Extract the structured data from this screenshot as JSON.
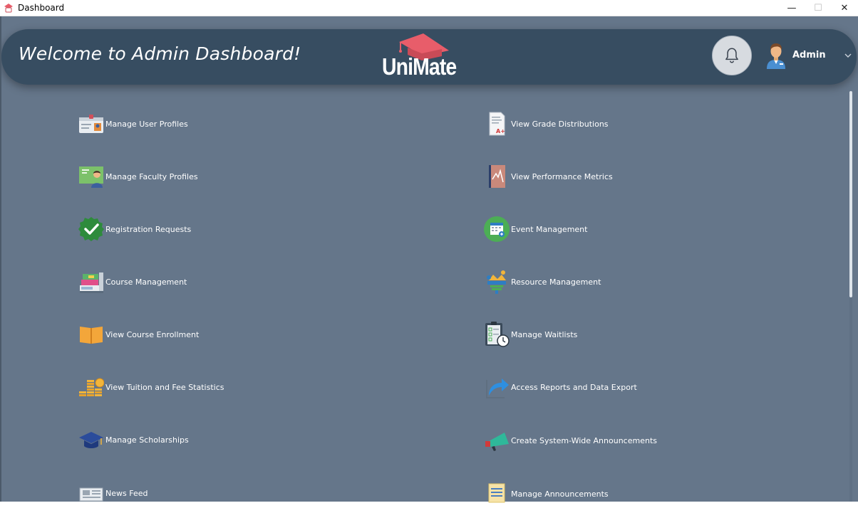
{
  "window": {
    "title": "Dashboard",
    "minimize": "—",
    "maximize": "☐",
    "close": "✕"
  },
  "header": {
    "welcome": "Welcome to Admin Dashboard!",
    "logo_text": "UniMate",
    "user_name": "Admin"
  },
  "menu": {
    "left": [
      {
        "label": "Manage User Profiles",
        "icon": "id-card-icon"
      },
      {
        "label": "Manage Faculty Profiles",
        "icon": "faculty-icon"
      },
      {
        "label": "Registration Requests",
        "icon": "check-badge-icon"
      },
      {
        "label": "Course Management",
        "icon": "books-icon"
      },
      {
        "label": "View Course Enrollment",
        "icon": "open-book-icon"
      },
      {
        "label": "View Tuition and Fee Statistics",
        "icon": "coins-icon"
      },
      {
        "label": "Manage Scholarships",
        "icon": "graduation-cap-icon"
      },
      {
        "label": "News Feed",
        "icon": "newspaper-icon"
      }
    ],
    "right": [
      {
        "label": "View Grade Distributions",
        "icon": "grade-sheet-icon"
      },
      {
        "label": "View Performance Metrics",
        "icon": "metrics-book-icon"
      },
      {
        "label": "Event Management",
        "icon": "calendar-icon"
      },
      {
        "label": "Resource Management",
        "icon": "resources-icon"
      },
      {
        "label": "Manage Waitlists",
        "icon": "clipboard-clock-icon"
      },
      {
        "label": "Access Reports and Data Export",
        "icon": "export-icon"
      },
      {
        "label": "Create System-Wide Announcements",
        "icon": "megaphone-icon"
      },
      {
        "label": "Manage Announcements",
        "icon": "notepad-icon"
      }
    ]
  },
  "colors": {
    "background": "#65768a",
    "header": "#374d61",
    "logo_cap": "#e85d6a"
  }
}
